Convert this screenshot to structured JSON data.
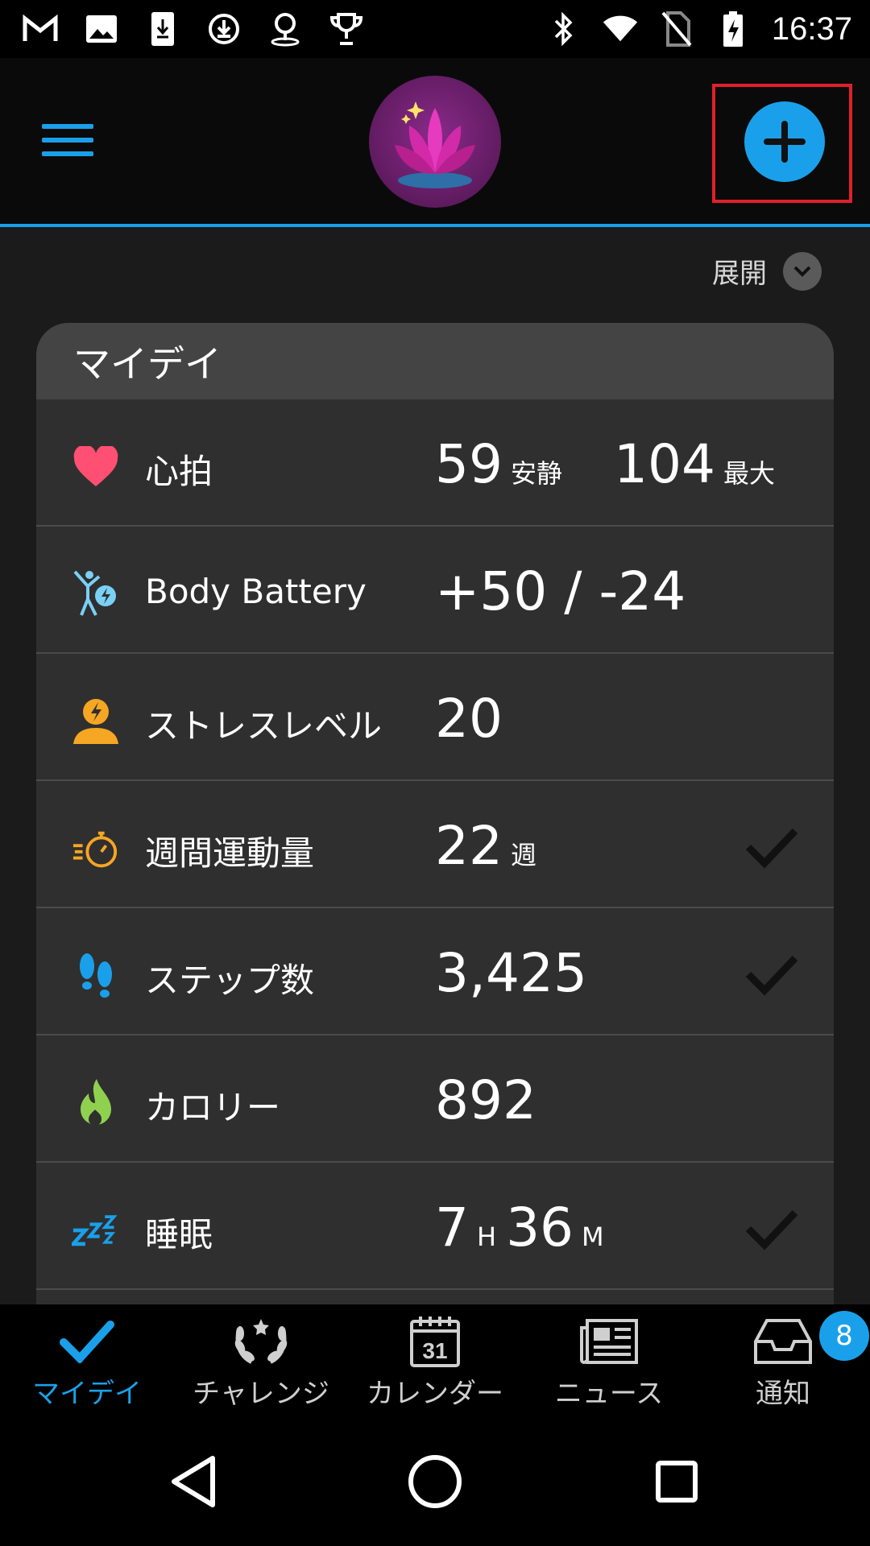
{
  "status_bar": {
    "time": "16:37",
    "left_icons": [
      "gmail-icon",
      "gallery-icon",
      "download-icon",
      "update-icon",
      "map-pin-icon",
      "trophy-icon"
    ],
    "right_icons": [
      "bluetooth-icon",
      "wifi-icon",
      "no-sim-icon",
      "battery-charging-icon"
    ]
  },
  "header": {
    "avatar": "lotus-avatar"
  },
  "expand": {
    "label": "展開"
  },
  "card": {
    "title": "マイデイ",
    "rows": [
      {
        "label": "心拍",
        "icon": "heart-icon",
        "value1": "59",
        "unit1": "安静",
        "value2": "104",
        "unit2": "最大",
        "checked": false
      },
      {
        "label": "Body Battery",
        "icon": "body-battery-icon",
        "value1": "+50 / -24",
        "checked": false
      },
      {
        "label": "ストレスレベル",
        "icon": "stress-icon",
        "value1": "20",
        "checked": false
      },
      {
        "label": "週間運動量",
        "icon": "stopwatch-icon",
        "value1": "22",
        "unit1": "週",
        "checked": true
      },
      {
        "label": "ステップ数",
        "icon": "footsteps-icon",
        "value1": "3,425",
        "checked": true
      },
      {
        "label": "カロリー",
        "icon": "flame-icon",
        "value1": "892",
        "checked": false
      },
      {
        "label": "睡眠",
        "icon": "sleep-icon",
        "value1": "7",
        "unit1": "H",
        "value2": "36",
        "unit2": "M",
        "checked": true
      }
    ]
  },
  "bottom_nav": {
    "items": [
      {
        "label": "マイデイ",
        "icon": "check-icon",
        "active": true
      },
      {
        "label": "チャレンジ",
        "icon": "laurel-icon",
        "active": false
      },
      {
        "label": "カレンダー",
        "icon": "calendar-icon",
        "calendar_day": "31",
        "active": false
      },
      {
        "label": "ニュース",
        "icon": "news-icon",
        "active": false
      },
      {
        "label": "通知",
        "icon": "inbox-icon",
        "active": false
      }
    ],
    "badge": "8"
  },
  "colors": {
    "accent": "#1aa0ea",
    "highlight": "#e0202a",
    "heart": "#ff4f72",
    "stress": "#f5a623",
    "calorie": "#8fd14f"
  }
}
